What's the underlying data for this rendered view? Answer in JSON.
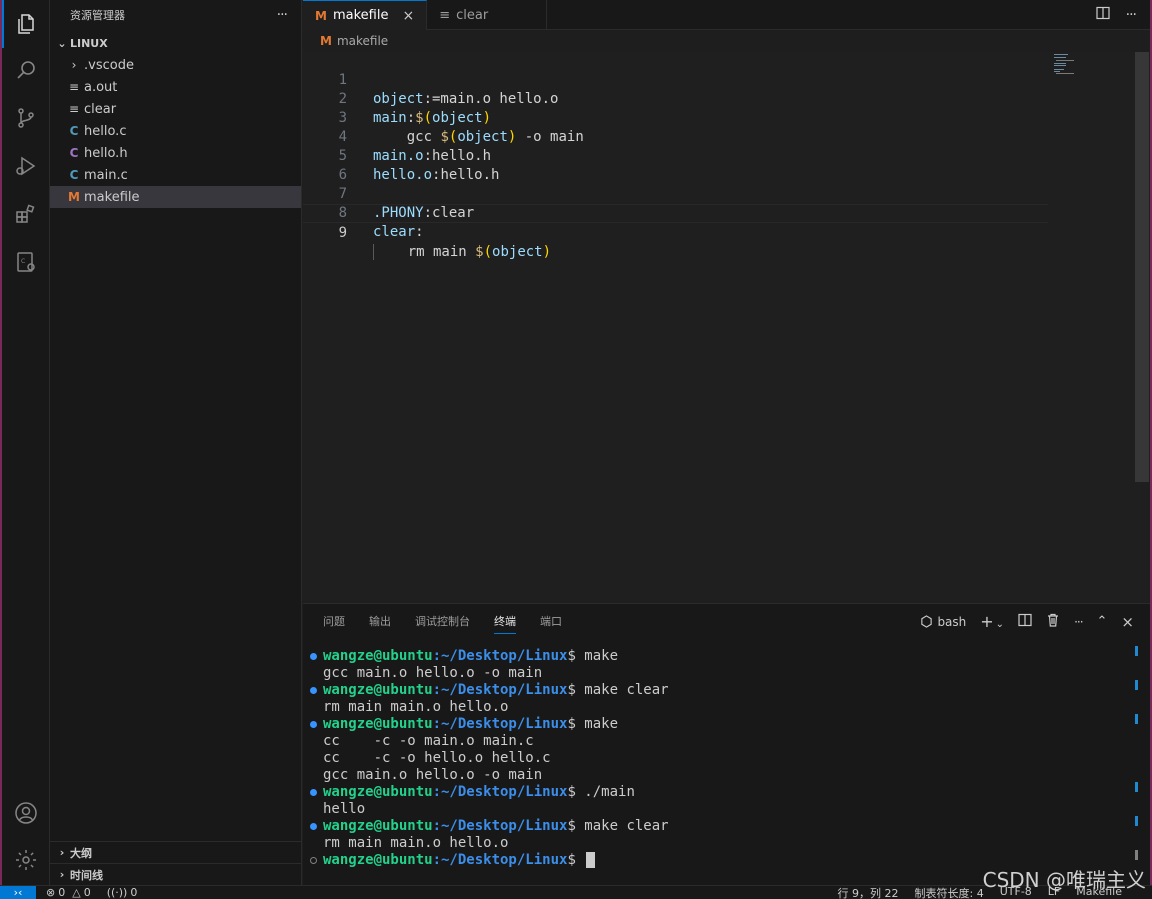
{
  "explorer": {
    "title": "资源管理器",
    "more": "···",
    "folder": "LINUX",
    "items": [
      {
        "label": ".vscode",
        "icon": "chevron-right-icon"
      },
      {
        "label": "a.out",
        "icon": "file-lines-icon"
      },
      {
        "label": "clear",
        "icon": "file-lines-icon"
      },
      {
        "label": "hello.c",
        "icon": "c-file-icon"
      },
      {
        "label": "hello.h",
        "icon": "h-file-icon"
      },
      {
        "label": "main.c",
        "icon": "c-file-icon"
      },
      {
        "label": "makefile",
        "icon": "makefile-icon"
      }
    ],
    "outline": "大纲",
    "timeline": "时间线"
  },
  "tabs": {
    "active": "makefile",
    "inactive": "clear",
    "close": "×"
  },
  "breadcrumb": "makefile",
  "editor": {
    "line_numbers": [
      "1",
      "2",
      "3",
      "4",
      "5",
      "6",
      "7",
      "8",
      "9"
    ],
    "current_line": 9
  },
  "panel": {
    "tabs": [
      "问题",
      "输出",
      "调试控制台",
      "终端",
      "端口"
    ],
    "active_tab": "终端",
    "shell": "bash",
    "terminal": [
      {
        "prompt": true,
        "cmd": " make"
      },
      {
        "prompt": false,
        "text": "gcc main.o hello.o -o main"
      },
      {
        "prompt": true,
        "cmd": " make clear"
      },
      {
        "prompt": false,
        "text": "rm main main.o hello.o"
      },
      {
        "prompt": true,
        "cmd": " make"
      },
      {
        "prompt": false,
        "text": "cc    -c -o main.o main.c"
      },
      {
        "prompt": false,
        "text": "cc    -c -o hello.o hello.c"
      },
      {
        "prompt": false,
        "text": "gcc main.o hello.o -o main"
      },
      {
        "prompt": true,
        "cmd": " ./main"
      },
      {
        "prompt": false,
        "text": "hello"
      },
      {
        "prompt": true,
        "cmd": " make clear"
      },
      {
        "prompt": false,
        "text": "rm main main.o hello.o"
      },
      {
        "prompt": true,
        "cmd": " ",
        "last": true
      }
    ],
    "user": "wangze@ubuntu",
    "path": ":~/Desktop/Linux",
    "dollar": "$"
  },
  "status": {
    "errors": "0",
    "warnings": "0",
    "ports": "0",
    "position": "行 9，列 22",
    "indent": "制表符长度: 4",
    "encoding": "UTF-8",
    "eol": "LF",
    "language": "Makefile"
  },
  "watermark": "CSDN @唯瑞主义",
  "colors": {
    "accent": "#0078d4",
    "prompt_user": "#23d18b",
    "prompt_path": "#3b8eea"
  }
}
